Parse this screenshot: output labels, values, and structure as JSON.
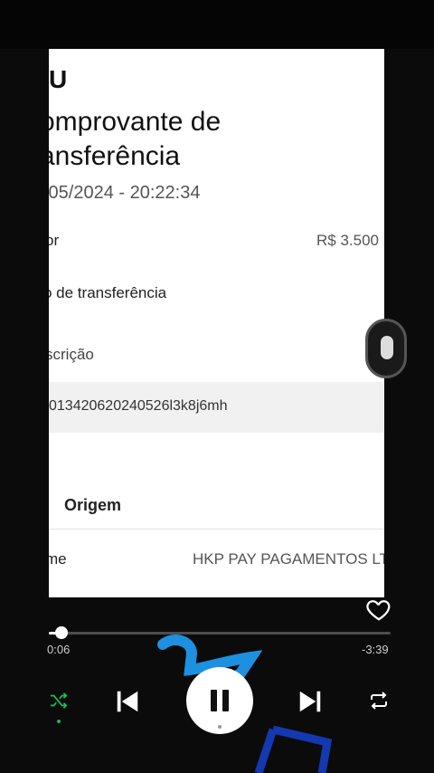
{
  "receipt": {
    "logo": "U",
    "title_line1": "omprovante de",
    "title_line2": "ansferência",
    "datetime": "/05/2024 - 20:22:34",
    "value_label": "or",
    "value_amount": "R$ 3.500",
    "type_label": "o de transferência",
    "description_label": "scrição",
    "description_value": "013420620240526l3k8j6mh",
    "origin_heading": "Origem",
    "name_label": "me",
    "name_value": "HKP PAY PAGAMENTOS LT"
  },
  "player": {
    "elapsed": "0:06",
    "remaining": "-3:39",
    "progress_fraction": 0.037,
    "liked": false,
    "shuffle_active": true,
    "accent_color": "#1db954",
    "icons": [
      "heart-icon",
      "shuffle-icon",
      "previous-icon",
      "pause-icon",
      "next-icon",
      "repeat-icon"
    ]
  }
}
